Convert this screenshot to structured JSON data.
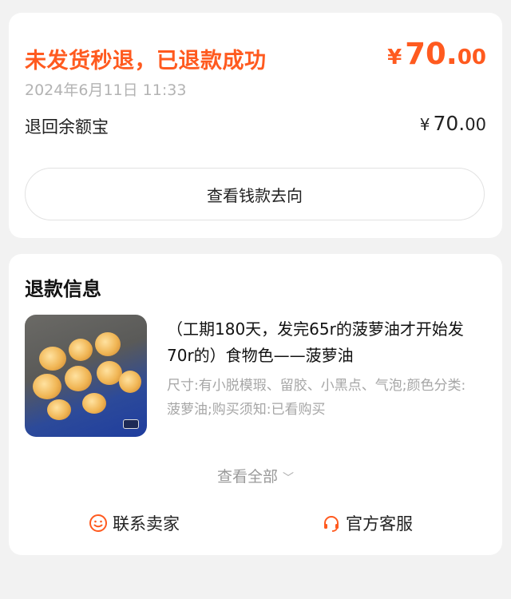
{
  "refund": {
    "status": "未发货秒退，已退款成功",
    "currency": "¥",
    "amount_int": "70.",
    "amount_dec": "00",
    "time": "2024年6月11日 11:33",
    "destination": "退回余额宝",
    "dest_amount_int": "70.",
    "dest_amount_dec": "00",
    "track_button": "查看钱款去向"
  },
  "info": {
    "title": "退款信息",
    "product_title": "（工期180天，发完65r的菠萝油才开始发70r的）食物色——菠萝油",
    "product_spec": "尺寸:有小脱模瑕、留胶、小黑点、气泡;颜色分类:菠萝油;购买须知:已看购买",
    "view_all": "查看全部",
    "contact_seller": "联系卖家",
    "customer_service": "官方客服"
  },
  "colors": {
    "accent": "#ff5a1f",
    "background": "#f2f2f2"
  }
}
